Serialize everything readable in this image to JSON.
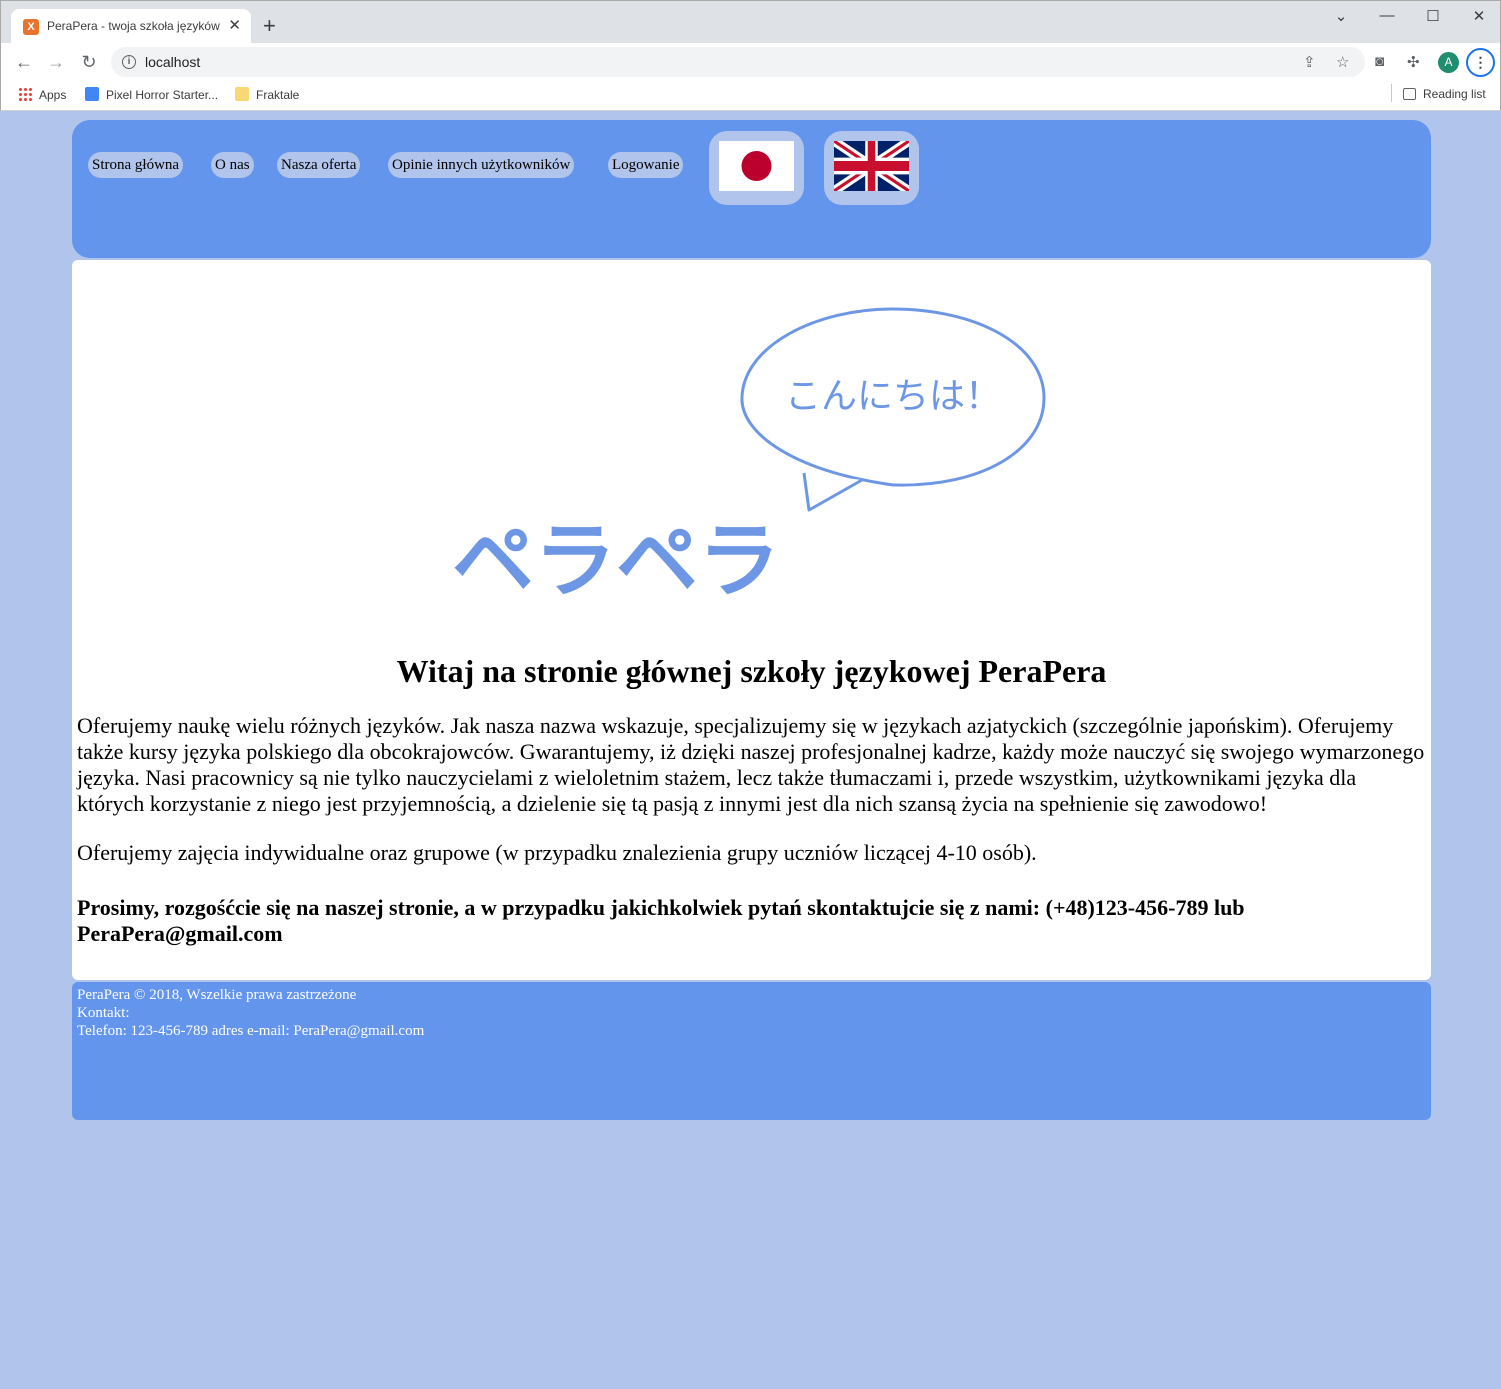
{
  "browser": {
    "tab_title": "PeraPera - twoja szkoła języków obcych",
    "favicon_letter": "X",
    "url": "localhost",
    "avatar_letter": "A",
    "bookmarks": {
      "apps": "Apps",
      "pixel_horror": "Pixel Horror Starter...",
      "fraktale": "Fraktale",
      "reading_list": "Reading list"
    }
  },
  "nav": {
    "items": [
      {
        "label": "Strona główna"
      },
      {
        "label": "O nas"
      },
      {
        "label": "Nasza oferta"
      },
      {
        "label": "Opinie innych użytkowników"
      },
      {
        "label": "Logowanie"
      }
    ]
  },
  "logo": {
    "greeting": "こんにちは！",
    "name": "ペラペラ"
  },
  "main": {
    "heading": "Witaj na stronie głównej szkoły językowej PeraPera",
    "paragraph1": "Oferujemy naukę wielu różnych języków. Jak nasza nazwa wskazuje, specjalizujemy się w językach azjatyckich (szczególnie japońskim). Oferujemy także kursy języka polskiego dla obcokrajowców. Gwarantujemy, iż dzięki naszej profesjonalnej kadrze, każdy może nauczyć się swojego wymarzonego języka. Nasi pracownicy są nie tylko nauczycielami z wieloletnim stażem, lecz także tłumaczami i, przede wszystkim, użytkownikami języka dla których korzystanie z niego jest przyjemnością, a dzielenie się tą pasją z innymi jest dla nich szansą życia na spełnienie się zawodowo!",
    "paragraph2": "Oferujemy zajęcia indywidualne oraz grupowe (w przypadku znalezienia grupy uczniów liczącej 4-10 osób).",
    "contact_bold": "Prosimy, rozgośćcie się na naszej stronie, a w przypadku jakichkolwiek pytań skontaktujcie się z nami: (+48)123-456-789 lub PeraPera@gmail.com"
  },
  "footer": {
    "copyright": "PeraPera © 2018, Wszelkie prawa zastrzeżone",
    "contact_label": "Kontakt:",
    "contact_details": "Telefon: 123-456-789 adres e-mail: PeraPera@gmail.com"
  },
  "colors": {
    "page_background": "#b0c4ec",
    "header_footer": "#6495ed",
    "logo_blue": "#6d97e4",
    "japan_red": "#bc002d"
  }
}
